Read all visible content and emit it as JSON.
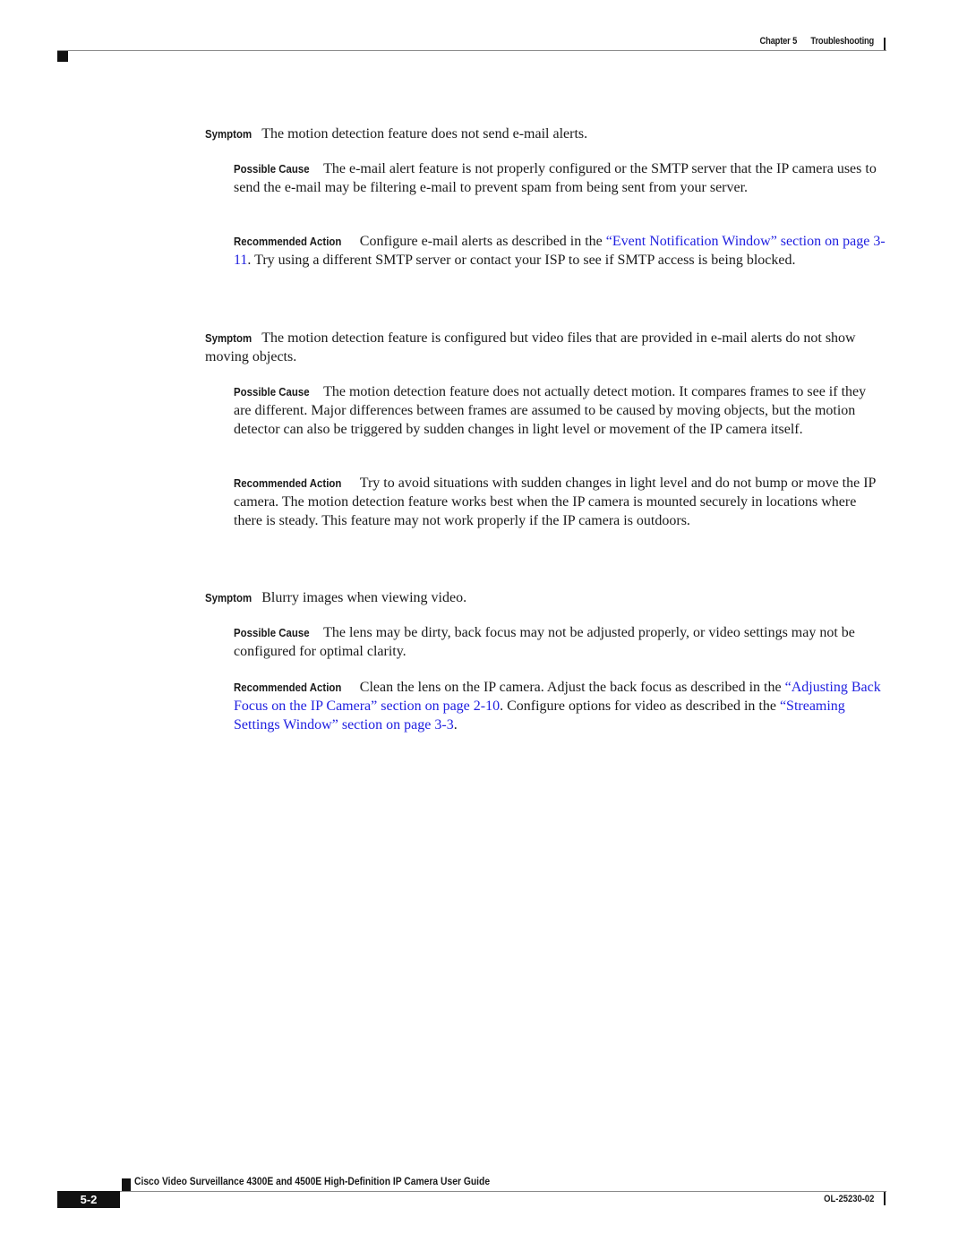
{
  "header": {
    "chapter": "Chapter 5",
    "section": "Troubleshooting"
  },
  "entries": [
    {
      "symptom_label": "Symptom",
      "symptom": "The motion detection feature does not send e-mail alerts.",
      "cause_label": "Possible Cause",
      "cause": "The e-mail alert feature is not properly configured or the SMTP server that the IP camera uses to send the e-mail may be filtering e-mail to prevent spam from being sent from your server.",
      "action_label": "Recommended Action",
      "action_pre": "Configure e-mail alerts as described in the ",
      "action_link1": "“Event Notification Window” section on page 3-11",
      "action_post": ". Try using a different SMTP server or contact your ISP to see if SMTP access is being blocked."
    },
    {
      "symptom_label": "Symptom",
      "symptom": "The motion detection feature is configured but video files that are provided in e-mail alerts do not show moving objects.",
      "cause_label": "Possible Cause",
      "cause": "The motion detection feature does not actually detect motion. It compares frames to see if they are different. Major differences between frames are assumed to be caused by moving objects, but the motion detector can also be triggered by sudden changes in light level or movement of the IP camera itself.",
      "action_label": "Recommended Action",
      "action": "Try to avoid situations with sudden changes in light level and do not bump or move the IP camera. The motion detection feature works best when the IP camera is mounted securely in locations where there is steady. This feature may not work properly if the IP camera is outdoors."
    },
    {
      "symptom_label": "Symptom",
      "symptom": "Blurry images when viewing video.",
      "cause_label": "Possible Cause",
      "cause": "The lens may be dirty, back focus may not be adjusted properly, or video settings may not be configured for optimal clarity.",
      "action_label": "Recommended Action",
      "action_pre": "Clean the lens on the IP camera. Adjust the back focus as described in the ",
      "action_link1": "“Adjusting Back Focus on the IP Camera” section on page 2-10",
      "action_mid": ". Configure options for video as described in the ",
      "action_link2": "“Streaming Settings Window” section on page 3-3",
      "action_post": "."
    }
  ],
  "footer": {
    "title": "Cisco Video Surveillance 4300E and 4500E High-Definition IP Camera User Guide",
    "page_number": "5-2",
    "doc_number": "OL-25230-02"
  }
}
